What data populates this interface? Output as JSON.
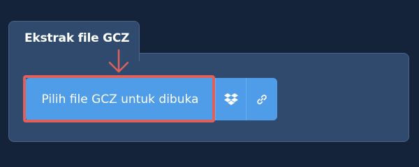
{
  "tab": {
    "title": "Ekstrak file GCZ"
  },
  "actions": {
    "choose_file_label": "Pilih file GCZ untuk dibuka",
    "dropbox_icon": "dropbox-icon",
    "link_icon": "link-icon"
  },
  "colors": {
    "page_background": "#14223a",
    "panel_background": "#2f4a6d",
    "button_blue": "#4f9de8",
    "highlight_red": "#e0615a"
  }
}
